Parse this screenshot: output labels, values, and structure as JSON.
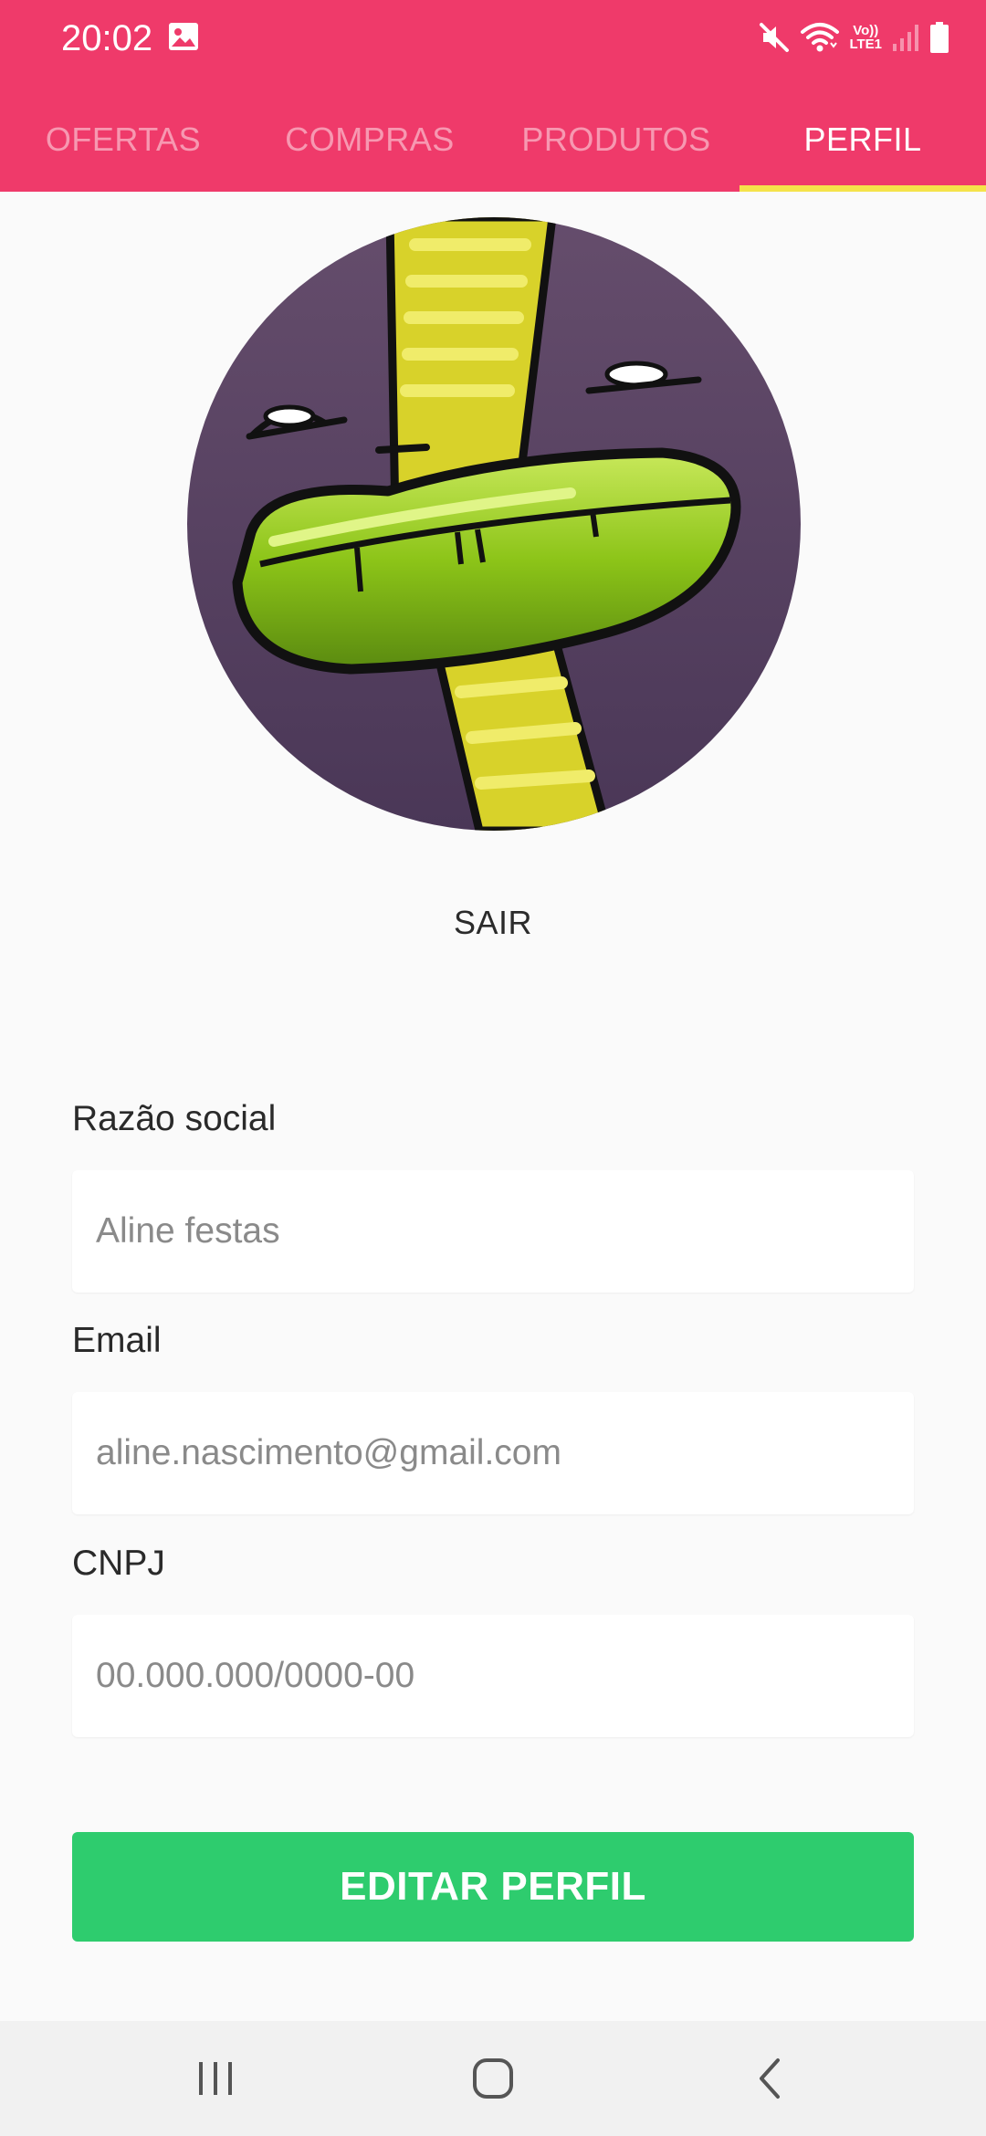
{
  "status_bar": {
    "time": "20:02",
    "icons": [
      "gallery-icon",
      "mute-icon",
      "wifi-icon",
      "volte-icon",
      "signal-icon",
      "battery-icon"
    ],
    "volte_top": "Vo))",
    "volte_bottom": "LTE1"
  },
  "tabs": [
    {
      "label": "OFERTAS",
      "active": false
    },
    {
      "label": "COMPRAS",
      "active": false
    },
    {
      "label": "PRODUTOS",
      "active": false
    },
    {
      "label": "PERFIL",
      "active": true
    }
  ],
  "profile": {
    "logout_label": "SAIR",
    "fields": [
      {
        "label": "Razão social",
        "placeholder": "Aline festas",
        "value": ""
      },
      {
        "label": "Email",
        "placeholder": "aline.nascimento@gmail.com",
        "value": ""
      },
      {
        "label": "CNPJ",
        "placeholder": "00.000.000/0000-00",
        "value": ""
      }
    ],
    "edit_button_label": "EDITAR PERFIL"
  },
  "nav_bar": {
    "icons": [
      "recent-apps-icon",
      "home-icon",
      "back-icon"
    ]
  },
  "colors": {
    "header": "#ef3a6a",
    "tab_indicator": "#f5e34a",
    "edit_button": "#2ecc6e",
    "background": "#fafafa",
    "avatar_background": "#5d4868"
  }
}
